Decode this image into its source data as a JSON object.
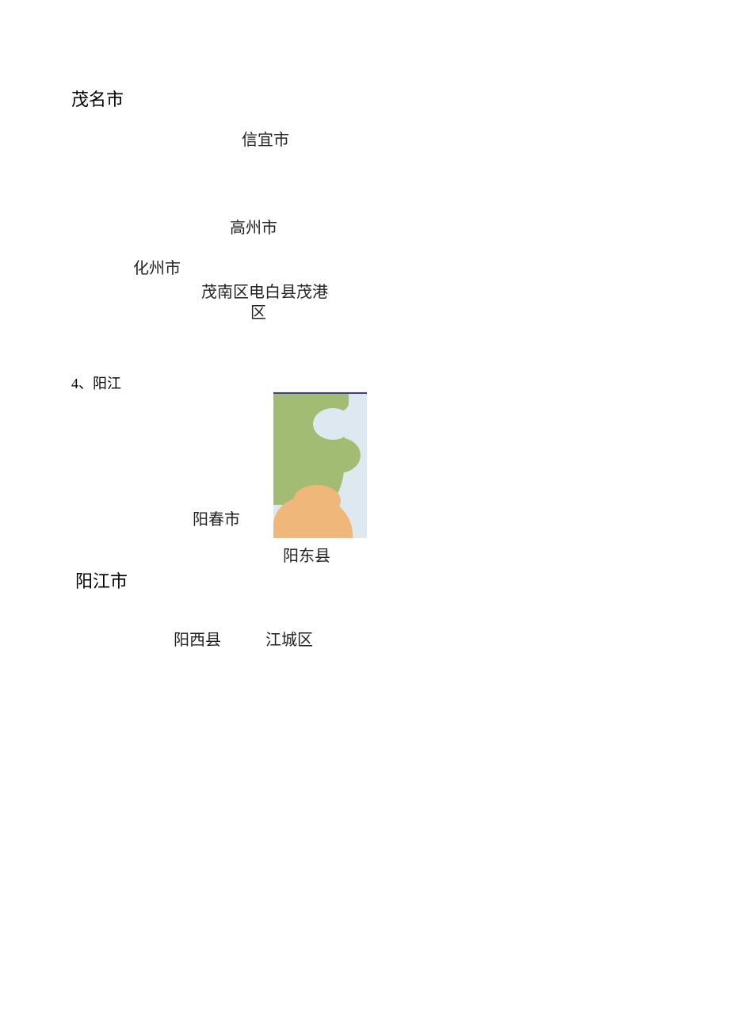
{
  "maoming": {
    "title": "茂名市",
    "xinyi": "信宜市",
    "gaozhou": "高州市",
    "huazhou": "化州市",
    "maonan_line": "茂南区电白县茂港",
    "maonan_line2": "区"
  },
  "section4": "4、阳江",
  "yangjiang": {
    "title": "阳江市",
    "yangchun": "阳春市",
    "yangdong": "阳东县",
    "yangxi": "阳西县",
    "jiangcheng": "江城区"
  }
}
